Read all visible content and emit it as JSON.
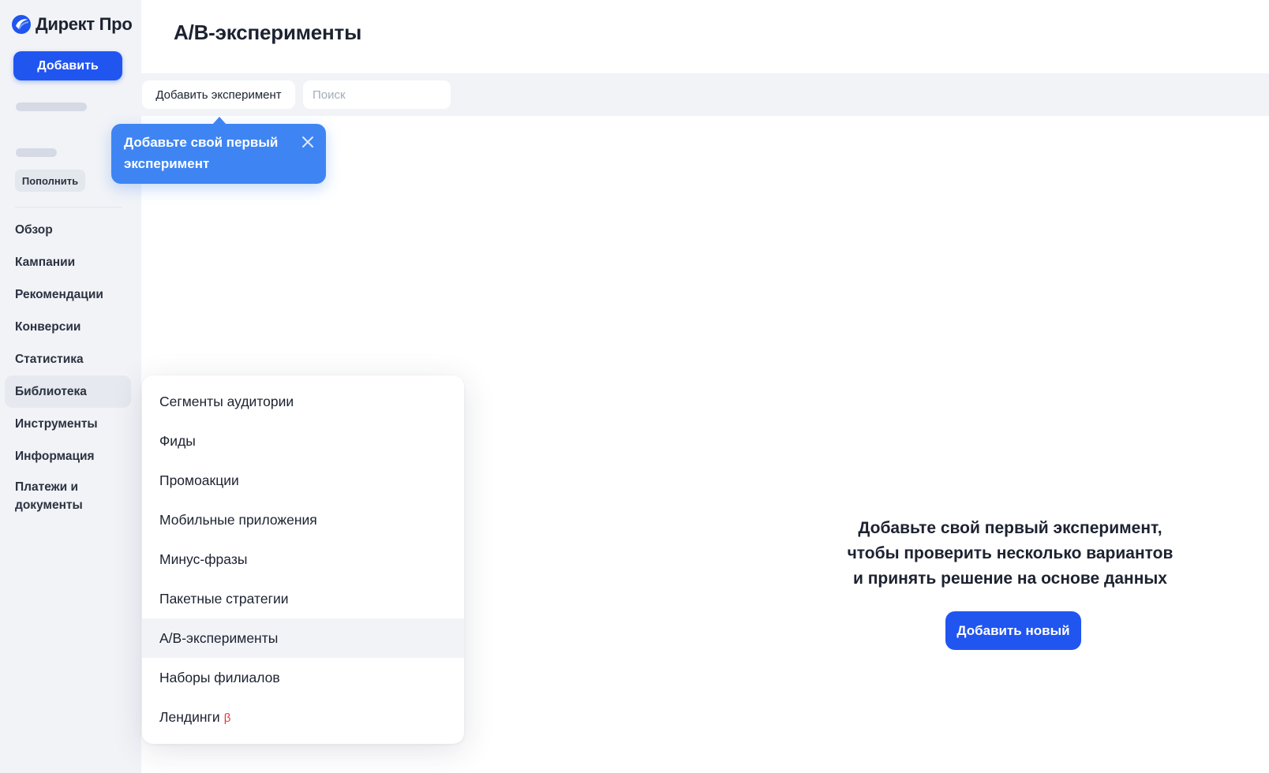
{
  "brand": {
    "logo_text": "Директ Про",
    "accent": "#2055f0"
  },
  "sidebar": {
    "add_label": "Добавить",
    "topup_label": "Пополнить",
    "nav": [
      {
        "label": "Обзор",
        "active": false
      },
      {
        "label": "Кампании",
        "active": false
      },
      {
        "label": "Рекомендации",
        "active": false
      },
      {
        "label": "Конверсии",
        "active": false
      },
      {
        "label": "Статистика",
        "active": false
      },
      {
        "label": "Библиотека",
        "active": true
      },
      {
        "label": "Инструменты",
        "active": false
      },
      {
        "label": "Информация",
        "active": false
      },
      {
        "label": "Платежи и документы",
        "active": false
      }
    ]
  },
  "header": {
    "title": "A/B-эксперименты"
  },
  "toolbar": {
    "add_experiment_label": "Добавить эксперимент",
    "search_placeholder": "Поиск",
    "search_value": ""
  },
  "tooltip": {
    "text": "Добавьте свой первый эксперимент",
    "close_icon": "close-icon"
  },
  "library_menu": {
    "items": [
      {
        "label": "Сегменты аудитории",
        "active": false
      },
      {
        "label": "Фиды",
        "active": false
      },
      {
        "label": "Промоакции",
        "active": false
      },
      {
        "label": "Мобильные приложения",
        "active": false
      },
      {
        "label": "Минус-фразы",
        "active": false
      },
      {
        "label": "Пакетные стратегии",
        "active": false
      },
      {
        "label": "A/B-эксперименты",
        "active": true
      },
      {
        "label": "Наборы филиалов",
        "active": false
      },
      {
        "label": "Лендинги",
        "active": false,
        "badge": "β"
      }
    ]
  },
  "empty_state": {
    "line1": "Добавьте свой первый эксперимент,",
    "line2": "чтобы проверить несколько вариантов",
    "line3": "и принять решение на основе данных",
    "button_label": "Добавить новый"
  }
}
